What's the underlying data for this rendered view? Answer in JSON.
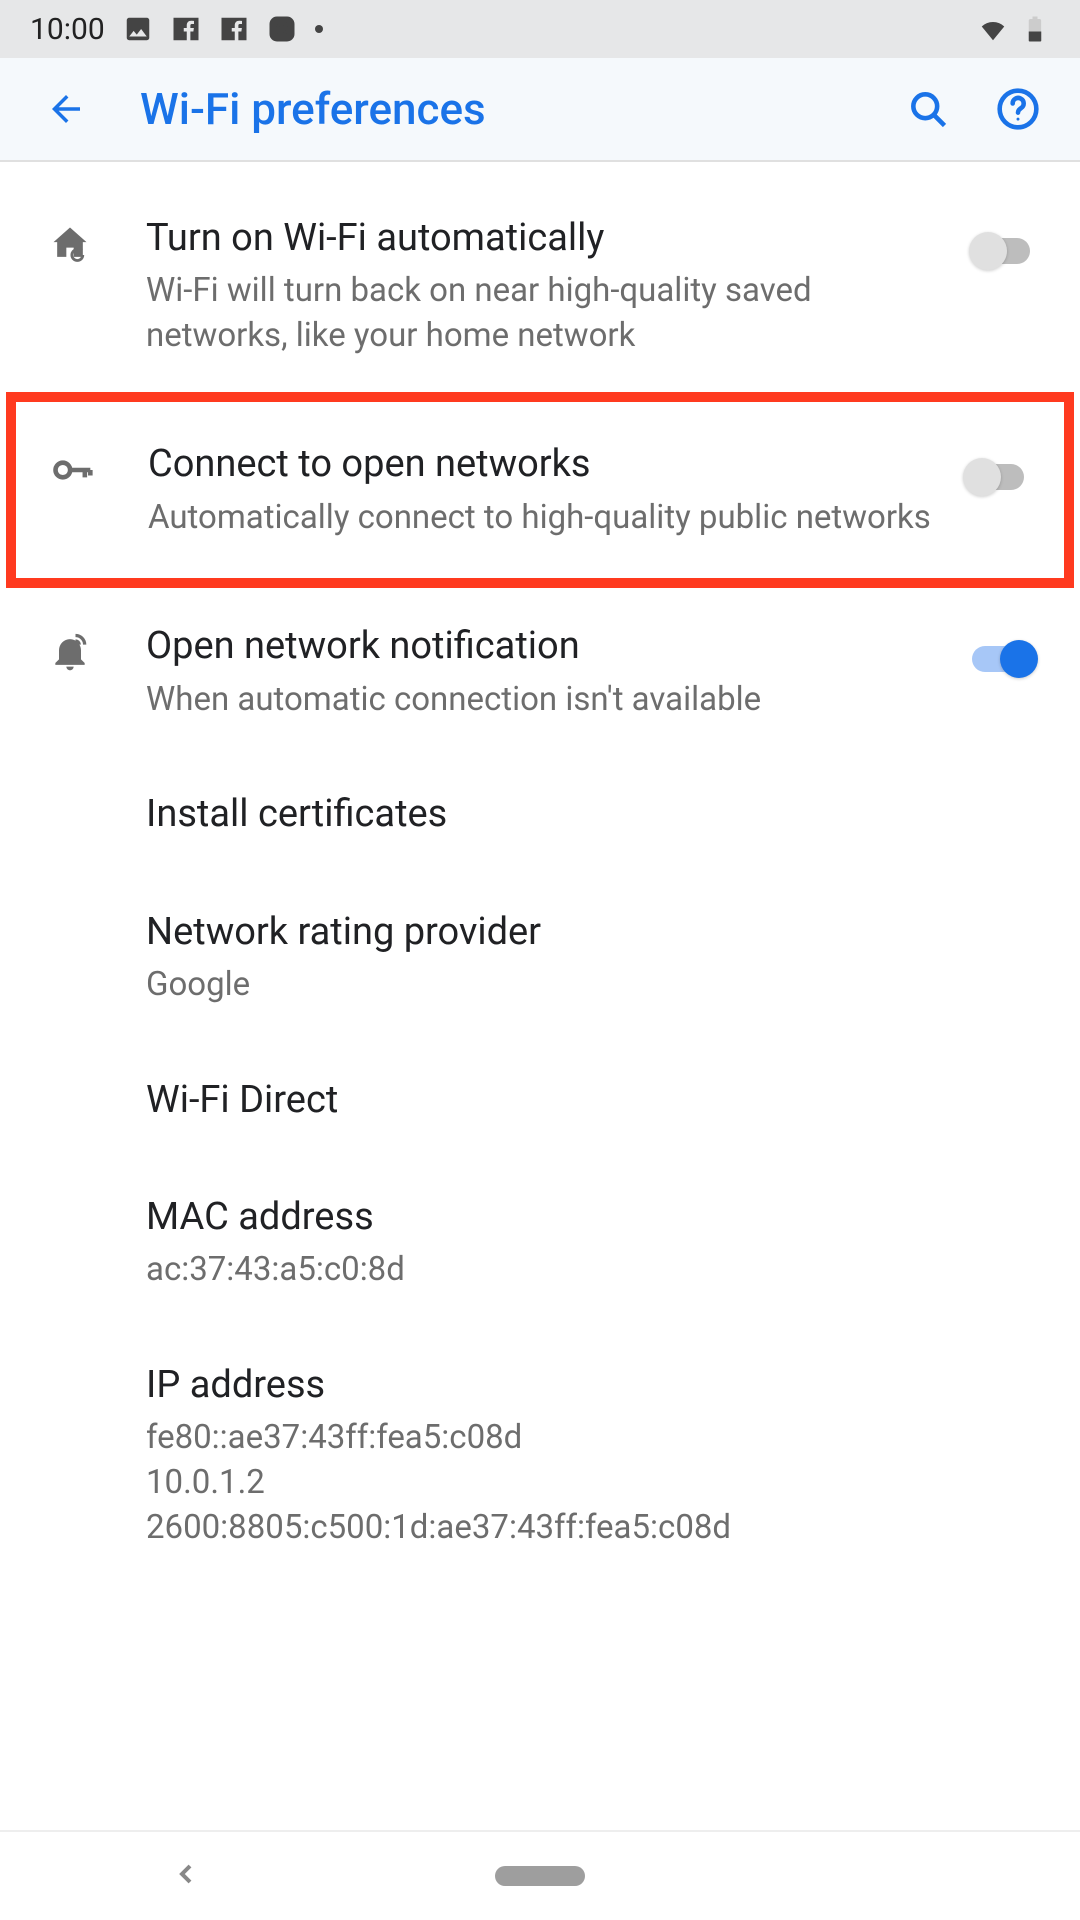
{
  "status_bar": {
    "time": "10:00"
  },
  "header": {
    "title": "Wi‑Fi preferences"
  },
  "settings": {
    "auto_wifi": {
      "title": "Turn on Wi‑Fi automatically",
      "sub": "Wi‑Fi will turn back on near high‑quality saved networks, like your home network",
      "on": false
    },
    "open_networks": {
      "title": "Connect to open networks",
      "sub": "Automatically connect to high‑quality public networks",
      "on": false
    },
    "open_notif": {
      "title": "Open network notification",
      "sub": "When automatic connection isn't available",
      "on": true
    },
    "install_certs": {
      "title": "Install certificates"
    },
    "rating_provider": {
      "title": "Network rating provider",
      "sub": "Google"
    },
    "wifi_direct": {
      "title": "Wi‑Fi Direct"
    },
    "mac": {
      "title": "MAC address",
      "sub": "ac:37:43:a5:c0:8d"
    },
    "ip": {
      "title": "IP address",
      "line1": "fe80::ae37:43ff:fea5:c08d",
      "line2": "10.0.1.2",
      "line3": "2600:8805:c500:1d:ae37:43ff:fea5:c08d"
    }
  }
}
